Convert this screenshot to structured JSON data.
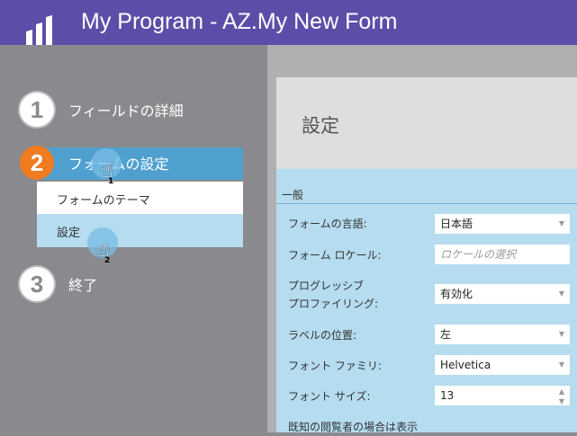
{
  "window": {
    "title": "My Program - AZ.My New Form",
    "logo_icon": "marketo-logo-icon"
  },
  "steps": [
    {
      "number": "1",
      "label": "フィールドの詳細"
    },
    {
      "number": "2",
      "label": "フォームの設定"
    },
    {
      "number": "3",
      "label": "終了"
    }
  ],
  "submenu": [
    "フォームのテーマ",
    "設定"
  ],
  "click_markers": [
    "1",
    "2"
  ],
  "settings": {
    "title": "設定",
    "section": "一般",
    "rows": [
      {
        "label": "フォームの言語:",
        "value": "日本語",
        "kind": "select"
      },
      {
        "label": "フォーム ロケール:",
        "value": "",
        "placeholder": "ロケールの選択",
        "kind": "input"
      },
      {
        "label1": "プログレッシブ",
        "label2": "プロファイリング:",
        "value": "有効化",
        "kind": "select"
      },
      {
        "label": "ラベルの位置:",
        "value": "左",
        "kind": "select"
      },
      {
        "label": "フォント ファミリ:",
        "value": "Helvetica",
        "kind": "select"
      },
      {
        "label": "フォント サイズ:",
        "value": "13",
        "kind": "stepper"
      },
      {
        "label": "既知の閲覧者の場合は表示"
      }
    ]
  },
  "colors": {
    "titlebar": "#5b4ea8",
    "active_step": "#f07b20",
    "active_bar": "#4fa0cf",
    "panel": "#b5dcef"
  }
}
